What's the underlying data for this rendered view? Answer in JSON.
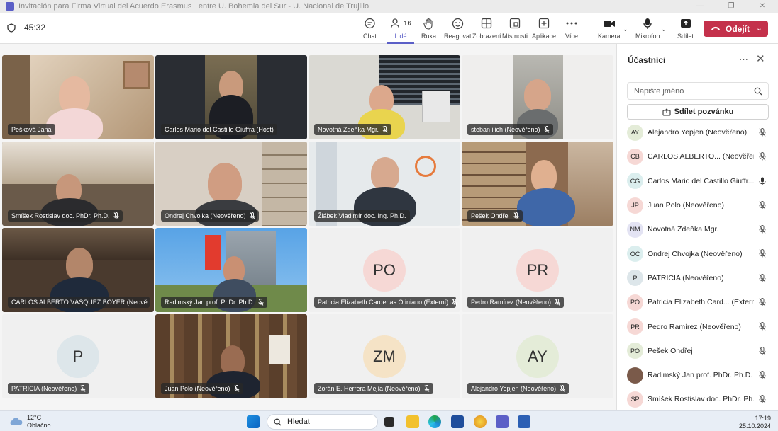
{
  "window": {
    "title": "Invitación para Firma Virtual del Acuerdo Erasmus+ entre U. Bohemia del Sur - U. Nacional de Trujillo",
    "controls": [
      "—",
      "❐",
      "✕"
    ]
  },
  "meeting": {
    "timer": "45:32",
    "participant_count": "16",
    "toolbar": [
      {
        "label": "Chat",
        "icon": "chat-icon"
      },
      {
        "label": "Lidé",
        "icon": "people-icon"
      },
      {
        "label": "Ruka",
        "icon": "hand-icon"
      },
      {
        "label": "Reagovat",
        "icon": "smile-icon"
      },
      {
        "label": "Zobrazení",
        "icon": "grid-icon"
      },
      {
        "label": "Místnosti",
        "icon": "rooms-icon"
      },
      {
        "label": "Aplikace",
        "icon": "plus-icon"
      },
      {
        "label": "Více",
        "icon": "more-icon"
      },
      {
        "label": "Kamera",
        "icon": "camera-icon"
      },
      {
        "label": "Mikrofon",
        "icon": "mic-icon"
      },
      {
        "label": "Sdílet",
        "icon": "share-icon"
      }
    ],
    "leave_label": "Odejít"
  },
  "tiles": [
    {
      "name": "Pešková Jana",
      "muted": false,
      "video": true
    },
    {
      "name": "Carlos Mario del Castillo Giuffra (Host)",
      "muted": false,
      "video": true
    },
    {
      "name": "Novotná Zdeňka Mgr.",
      "muted": true,
      "video": true
    },
    {
      "name": "steban ilich (Neověřeno)",
      "muted": true,
      "video": true
    },
    {
      "name": "Smíšek Rostislav doc. PhDr. Ph.D.",
      "muted": true,
      "video": true
    },
    {
      "name": "Ondrej Chvojka (Neověřeno)",
      "muted": true,
      "video": true
    },
    {
      "name": "Žlábek Vladimír doc. Ing. Ph.D.",
      "muted": false,
      "video": true
    },
    {
      "name": "Pešek Ondřej",
      "muted": true,
      "video": true
    },
    {
      "name": "CARLOS ALBERTO VÁSQUEZ BOYER (Neově...",
      "muted": true,
      "video": true
    },
    {
      "name": "Radimský Jan prof. PhDr. Ph.D.",
      "muted": true,
      "video": true
    },
    {
      "name": "Patricia Elizabeth Cardenas Otiniano (Externí)",
      "muted": true,
      "video": false,
      "initials": "PO",
      "color": "#f6d8d5"
    },
    {
      "name": "Pedro Ramírez (Neověřeno)",
      "muted": true,
      "video": false,
      "initials": "PR",
      "color": "#f6d8d5"
    },
    {
      "name": "PATRICIA (Neověřeno)",
      "muted": true,
      "video": false,
      "initials": "P",
      "color": "#dde6ea"
    },
    {
      "name": "Juan Polo (Neověřeno)",
      "muted": true,
      "video": true
    },
    {
      "name": "Zorán E. Herrera Mejía (Neověřeno)",
      "muted": true,
      "video": false,
      "initials": "ZM",
      "color": "#f5e3c6"
    },
    {
      "name": "Alejandro Yepjen (Neověřeno)",
      "muted": true,
      "video": false,
      "initials": "AY",
      "color": "#e4ecd8"
    }
  ],
  "panel": {
    "title": "Účastníci",
    "search_placeholder": "Napište jméno",
    "share_label": "Sdílet pozvánku",
    "participants": [
      {
        "initials": "AY",
        "name": "Alejandro Yepjen (Neověřeno)",
        "color": "#e4ecd8",
        "muted": true
      },
      {
        "initials": "CB",
        "name": "CARLOS ALBERTO... (Neověřeno)",
        "color": "#f6d8d5",
        "muted": true
      },
      {
        "initials": "CG",
        "name": "Carlos Mario del Castillo Giuffr...",
        "color": "#dbeeee",
        "muted": false
      },
      {
        "initials": "JP",
        "name": "Juan Polo (Neověřeno)",
        "color": "#f6d8d5",
        "muted": true
      },
      {
        "initials": "NM",
        "name": "Novotná Zdeňka Mgr.",
        "color": "#e3e3f3",
        "muted": true
      },
      {
        "initials": "OC",
        "name": "Ondrej Chvojka (Neověřeno)",
        "color": "#dbeeee",
        "muted": true
      },
      {
        "initials": "P",
        "name": "PATRICIA (Neověřeno)",
        "color": "#dde6ea",
        "muted": true
      },
      {
        "initials": "PO",
        "name": "Patricia Elizabeth Card... (Externí)",
        "color": "#f6d8d5",
        "muted": true
      },
      {
        "initials": "PR",
        "name": "Pedro Ramírez (Neověřeno)",
        "color": "#f6d8d5",
        "muted": true
      },
      {
        "initials": "PO",
        "name": "Pešek Ondřej",
        "color": "#e4ecd8",
        "muted": true
      },
      {
        "initials": "",
        "name": "Radimský Jan prof. PhDr. Ph.D.",
        "color": "#7a5a4a",
        "muted": true,
        "photo": true
      },
      {
        "initials": "SP",
        "name": "Smíšek Rostislav doc. PhDr. Ph...",
        "color": "#f6d8d5",
        "muted": true
      }
    ]
  },
  "taskbar": {
    "temperature": "12°C",
    "weather": "Oblačno",
    "search_placeholder": "Hledat",
    "time": "17:19",
    "date": "25.10.2024"
  }
}
